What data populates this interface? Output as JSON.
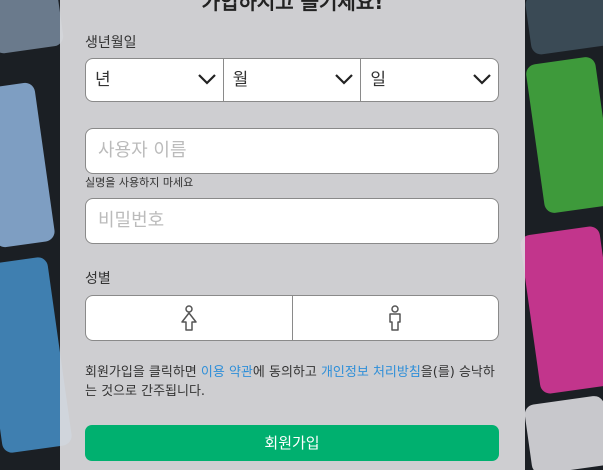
{
  "header": {
    "headline": "가입하시고 즐기세요!"
  },
  "birthday": {
    "label": "생년월일",
    "year": "년",
    "month": "월",
    "day": "일"
  },
  "username": {
    "placeholder": "사용자 이름",
    "hint": "실명을 사용하지 마세요"
  },
  "password": {
    "placeholder": "비밀번호"
  },
  "gender": {
    "label": "성별",
    "options": [
      "female-icon",
      "male-icon"
    ]
  },
  "terms": {
    "text_before": "회원가입을 클릭하면 ",
    "link_terms": "이용 약관",
    "text_middle": "에 동의하고 ",
    "link_privacy": "개인정보 처리방침",
    "text_after": "을(를) 승낙하는 것으로 간주됩니다."
  },
  "signup_button": {
    "label": "회원가입"
  },
  "colors": {
    "accent_green": "#00b06f",
    "link_blue": "#2f8fd8",
    "panel_bg": "#dcdcdf"
  }
}
